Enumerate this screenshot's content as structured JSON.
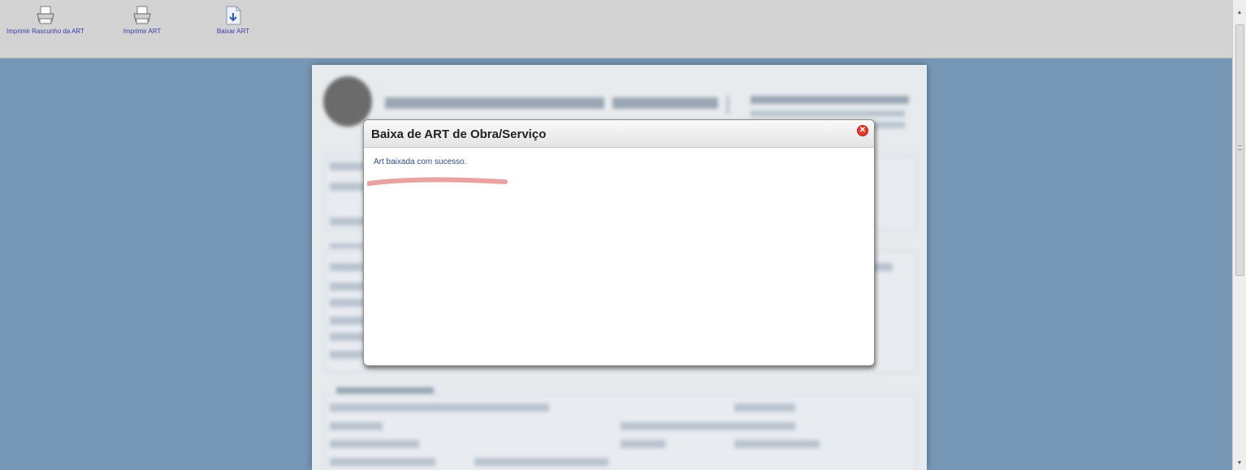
{
  "toolbar": {
    "items": [
      {
        "label": "Imprimir Rascunho da ART",
        "icon": "printer-icon"
      },
      {
        "label": "Imprimir ART",
        "icon": "printer-icon"
      },
      {
        "label": "Baixar ART",
        "icon": "download-document-icon"
      }
    ]
  },
  "modal": {
    "title": "Baixa de ART de Obra/Serviço",
    "message": "Art baixada com sucesso.",
    "close_icon": "close-icon"
  },
  "colors": {
    "background": "#7797b7",
    "toolbar": "#d3d3d3",
    "link": "#3a3aa8",
    "close": "#e23a2e"
  }
}
